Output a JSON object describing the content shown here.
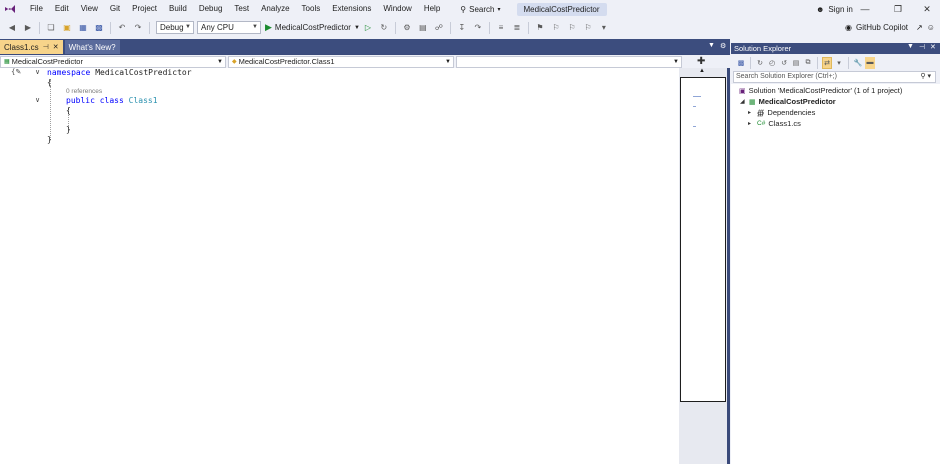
{
  "menu": {
    "items": [
      "File",
      "Edit",
      "View",
      "Git",
      "Project",
      "Build",
      "Debug",
      "Test",
      "Analyze",
      "Tools",
      "Extensions",
      "Window",
      "Help"
    ],
    "search_label": "Search",
    "solution_title": "MedicalCostPredictor",
    "sign_in": "Sign in"
  },
  "toolbar": {
    "configuration": "Debug",
    "platform": "Any CPU",
    "start_target": "MedicalCostPredictor",
    "copilot_label": "GitHub Copilot"
  },
  "tabs": [
    {
      "label": "Class1.cs",
      "active": true
    },
    {
      "label": "What's New?",
      "active": false
    }
  ],
  "navbar": {
    "project": "MedicalCostPredictor",
    "type": "MedicalCostPredictor.Class1",
    "member": ""
  },
  "code": {
    "line1_kw": "namespace",
    "line1_name": "MedicalCostPredictor",
    "brace_open": "{",
    "brace_close": "}",
    "references": "0 references",
    "class_kw1": "public",
    "class_kw2": "class",
    "class_name": "Class1"
  },
  "solution_explorer": {
    "title": "Solution Explorer",
    "search_placeholder": "Search Solution Explorer (Ctrl+;)",
    "solution": "Solution 'MedicalCostPredictor' (1 of 1 project)",
    "project": "MedicalCostPredictor",
    "dependencies": "Dependencies",
    "file": "Class1.cs"
  },
  "colors": {
    "accent": "#3c4d7e",
    "active_tab": "#f7d48a",
    "keyword": "#0000ff",
    "type": "#2b91af"
  }
}
